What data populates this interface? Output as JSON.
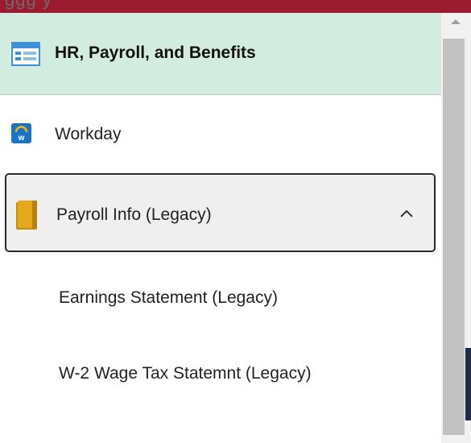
{
  "header": {
    "title": "HR, Payroll, and Benefits",
    "icon": "window-list-icon"
  },
  "menu": {
    "items": [
      {
        "label": "Workday",
        "icon": "workday-logo-icon"
      },
      {
        "label": "Payroll Info (Legacy)",
        "icon": "folder-icon",
        "expanded": true
      }
    ],
    "subitems": [
      {
        "label": "Earnings Statement (Legacy)"
      },
      {
        "label": "W-2 Wage Tax Statemnt (Legacy)"
      }
    ]
  },
  "colors": {
    "top_strip": "#9b1b30",
    "header_bg": "#d3ece0",
    "selected_bg": "#efefef",
    "selected_border": "#2b2b2b",
    "folder": "#d4a017",
    "workday_blue": "#1a73c6"
  }
}
